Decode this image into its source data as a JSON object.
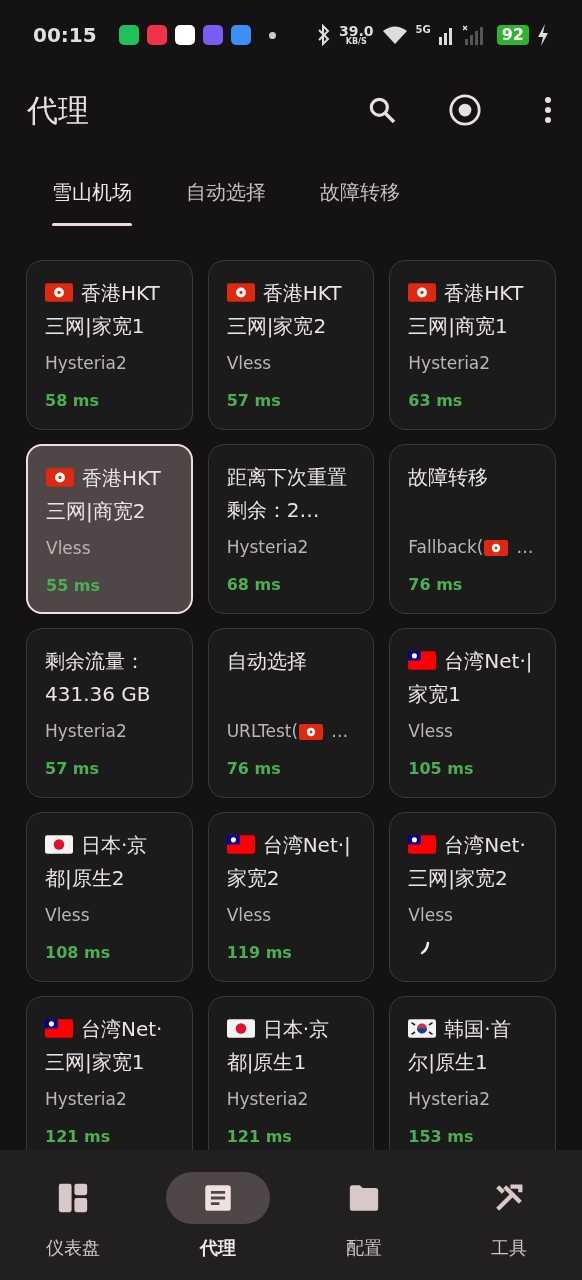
{
  "status_bar": {
    "time": "00:15",
    "speed": "39.0",
    "speed_unit": "KB/S",
    "network": "5G",
    "battery": "92"
  },
  "header": {
    "title": "代理"
  },
  "tabs": [
    {
      "label": "雪山机场",
      "selected": true
    },
    {
      "label": "自动选择",
      "selected": false
    },
    {
      "label": "故障转移",
      "selected": false
    }
  ],
  "proxies": [
    {
      "name": "香港HKT三网|家宽1",
      "type": "Hysteria2",
      "delay": "58 ms",
      "selected": false
    },
    {
      "name": "香港HKT三网|家宽2",
      "type": "Vless",
      "delay": "57 ms",
      "selected": false
    },
    {
      "name": "香港HKT三网|商宽1",
      "type": "Hysteria2",
      "delay": "63 ms",
      "selected": false
    },
    {
      "name": "香港HKT三网|商宽2",
      "type": "Vless",
      "delay": "55 ms",
      "selected": true
    },
    {
      "name": "距离下次重置剩余：2…",
      "type": "Hysteria2",
      "delay": "68 ms",
      "selected": false
    },
    {
      "name": "故障转移",
      "type": "Fallback(",
      "type_tail": "…",
      "delay": "76 ms",
      "selected": false
    },
    {
      "name": "剩余流量：431.36 GB",
      "type": "Hysteria2",
      "delay": "57 ms",
      "selected": false
    },
    {
      "name": "自动选择",
      "type": "URLTest(",
      "type_tail": "…",
      "delay": "76 ms",
      "selected": false
    },
    {
      "name": "台湾Net·|家宽1",
      "type": "Vless",
      "delay": "105 ms",
      "selected": false
    },
    {
      "name": "日本·京都|原生2",
      "type": "Vless",
      "delay": "108 ms",
      "selected": false
    },
    {
      "name": "台湾Net·|家宽2",
      "type": "Vless",
      "delay": "119 ms",
      "selected": false
    },
    {
      "name": "台湾Net·三网|家宽2",
      "type": "Vless",
      "testing": true,
      "selected": false
    },
    {
      "name": "台湾Net·三网|家宽1",
      "type": "Hysteria2",
      "delay": "121 ms",
      "selected": false
    },
    {
      "name": "日本·京都|原生1",
      "type": "Hysteria2",
      "delay": "121 ms",
      "selected": false
    },
    {
      "name": "韩国·首尔|原生1",
      "type": "Hysteria2",
      "delay": "153 ms",
      "selected": false
    }
  ],
  "nav": [
    {
      "label": "仪表盘",
      "selected": false
    },
    {
      "label": "代理",
      "selected": true
    },
    {
      "label": "配置",
      "selected": false
    },
    {
      "label": "工具",
      "selected": false
    }
  ]
}
